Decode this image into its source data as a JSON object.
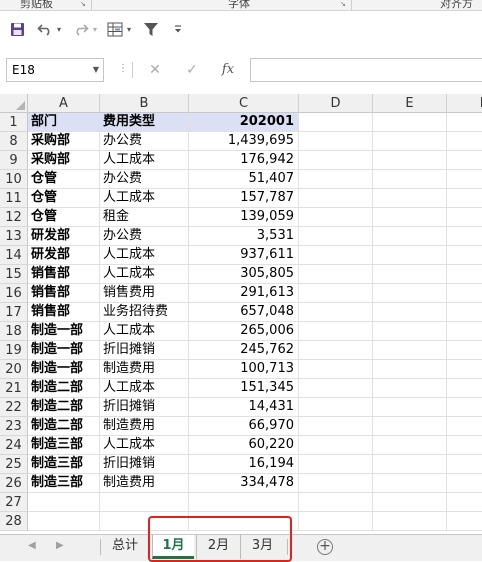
{
  "ribbon": {
    "groups": [
      "剪贴板",
      "字体",
      "对齐方式"
    ]
  },
  "quick_access": {
    "icons": [
      "save-icon",
      "undo-icon",
      "redo-icon",
      "form-icon",
      "filter-icon",
      "customize-icon"
    ]
  },
  "formula_bar": {
    "name_box": "E18",
    "fx_label": "fx",
    "value": ""
  },
  "columns": [
    "A",
    "B",
    "C",
    "D",
    "E",
    "F"
  ],
  "rows": [
    {
      "row": "1",
      "a": "部门",
      "b": "费用类型",
      "c": "202001",
      "header": true
    },
    {
      "row": "8",
      "a": "采购部",
      "b": "办公费",
      "c": "1,439,695"
    },
    {
      "row": "9",
      "a": "采购部",
      "b": "人工成本",
      "c": "176,942"
    },
    {
      "row": "10",
      "a": "仓管",
      "b": "办公费",
      "c": "51,407"
    },
    {
      "row": "11",
      "a": "仓管",
      "b": "人工成本",
      "c": "157,787"
    },
    {
      "row": "12",
      "a": "仓管",
      "b": "租金",
      "c": "139,059"
    },
    {
      "row": "13",
      "a": "研发部",
      "b": "办公费",
      "c": "3,531"
    },
    {
      "row": "14",
      "a": "研发部",
      "b": "人工成本",
      "c": "937,611"
    },
    {
      "row": "15",
      "a": "销售部",
      "b": "人工成本",
      "c": "305,805"
    },
    {
      "row": "16",
      "a": "销售部",
      "b": "销售费用",
      "c": "291,613"
    },
    {
      "row": "17",
      "a": "销售部",
      "b": "业务招待费",
      "c": "657,048"
    },
    {
      "row": "18",
      "a": "制造一部",
      "b": "人工成本",
      "c": "265,006"
    },
    {
      "row": "19",
      "a": "制造一部",
      "b": "折旧摊销",
      "c": "245,762"
    },
    {
      "row": "20",
      "a": "制造一部",
      "b": "制造费用",
      "c": "100,713"
    },
    {
      "row": "21",
      "a": "制造二部",
      "b": "人工成本",
      "c": "151,345"
    },
    {
      "row": "22",
      "a": "制造二部",
      "b": "折旧摊销",
      "c": "14,431"
    },
    {
      "row": "23",
      "a": "制造二部",
      "b": "制造费用",
      "c": "66,970"
    },
    {
      "row": "24",
      "a": "制造三部",
      "b": "人工成本",
      "c": "60,220"
    },
    {
      "row": "25",
      "a": "制造三部",
      "b": "折旧摊销",
      "c": "16,194"
    },
    {
      "row": "26",
      "a": "制造三部",
      "b": "制造费用",
      "c": "334,478"
    },
    {
      "row": "27",
      "a": "",
      "b": "",
      "c": ""
    },
    {
      "row": "28",
      "a": "",
      "b": "",
      "c": ""
    }
  ],
  "sheet_tabs": [
    {
      "label": "总计",
      "active": false
    },
    {
      "label": "1月",
      "active": true
    },
    {
      "label": "2月",
      "active": false
    },
    {
      "label": "3月",
      "active": false
    }
  ],
  "colors": {
    "header_fill": "#dce0f4",
    "active_tab": "#217346",
    "highlight_box": "#e0211e"
  }
}
